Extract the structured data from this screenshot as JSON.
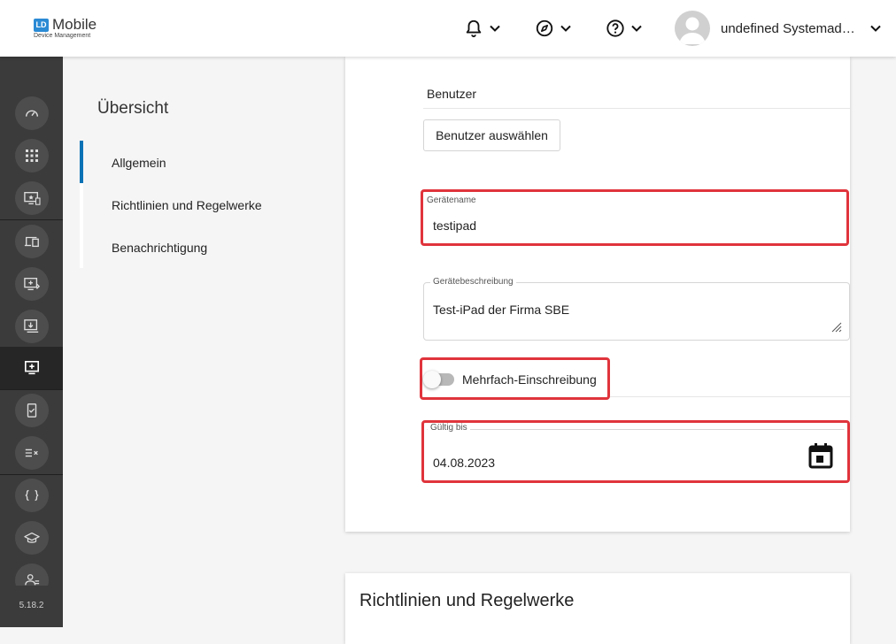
{
  "header": {
    "logo_badge": "LD",
    "logo_title": "Mobile",
    "logo_subtitle": "Device Management",
    "user_name": "undefined Systemadmi..."
  },
  "sidebar": {
    "icons": [
      "dashboard-icon",
      "apps-grid-icon",
      "device-star-icon",
      "devices-icon",
      "device-forward-icon",
      "device-download-icon",
      "device-add-icon",
      "phone-check-icon",
      "list-check-icon",
      "code-braces-icon",
      "school-icon",
      "user-group-icon"
    ],
    "version": "5.18.2"
  },
  "nav": {
    "title": "Übersicht",
    "items": [
      {
        "label": "Allgemein"
      },
      {
        "label": "Richtlinien und Regelwerke"
      },
      {
        "label": "Benachrichtigung"
      }
    ]
  },
  "form": {
    "user_section_label": "Benutzer",
    "select_user_button": "Benutzer auswählen",
    "device_name_label": "Gerätename",
    "device_name_value": "testipad",
    "device_description_label": "Gerätebeschreibung",
    "device_description_value": "Test-iPad der Firma SBE",
    "multi_enrollment_label": "Mehrfach-Einschreibung",
    "multi_enrollment_enabled": false,
    "valid_until_label": "Gültig bis",
    "valid_until_value": "04.08.2023"
  },
  "next_section": {
    "title": "Richtlinien und Regelwerke"
  },
  "colors": {
    "accent": "#0b72b5",
    "highlight": "#e0343c",
    "sidebar": "#3b3b3b"
  }
}
